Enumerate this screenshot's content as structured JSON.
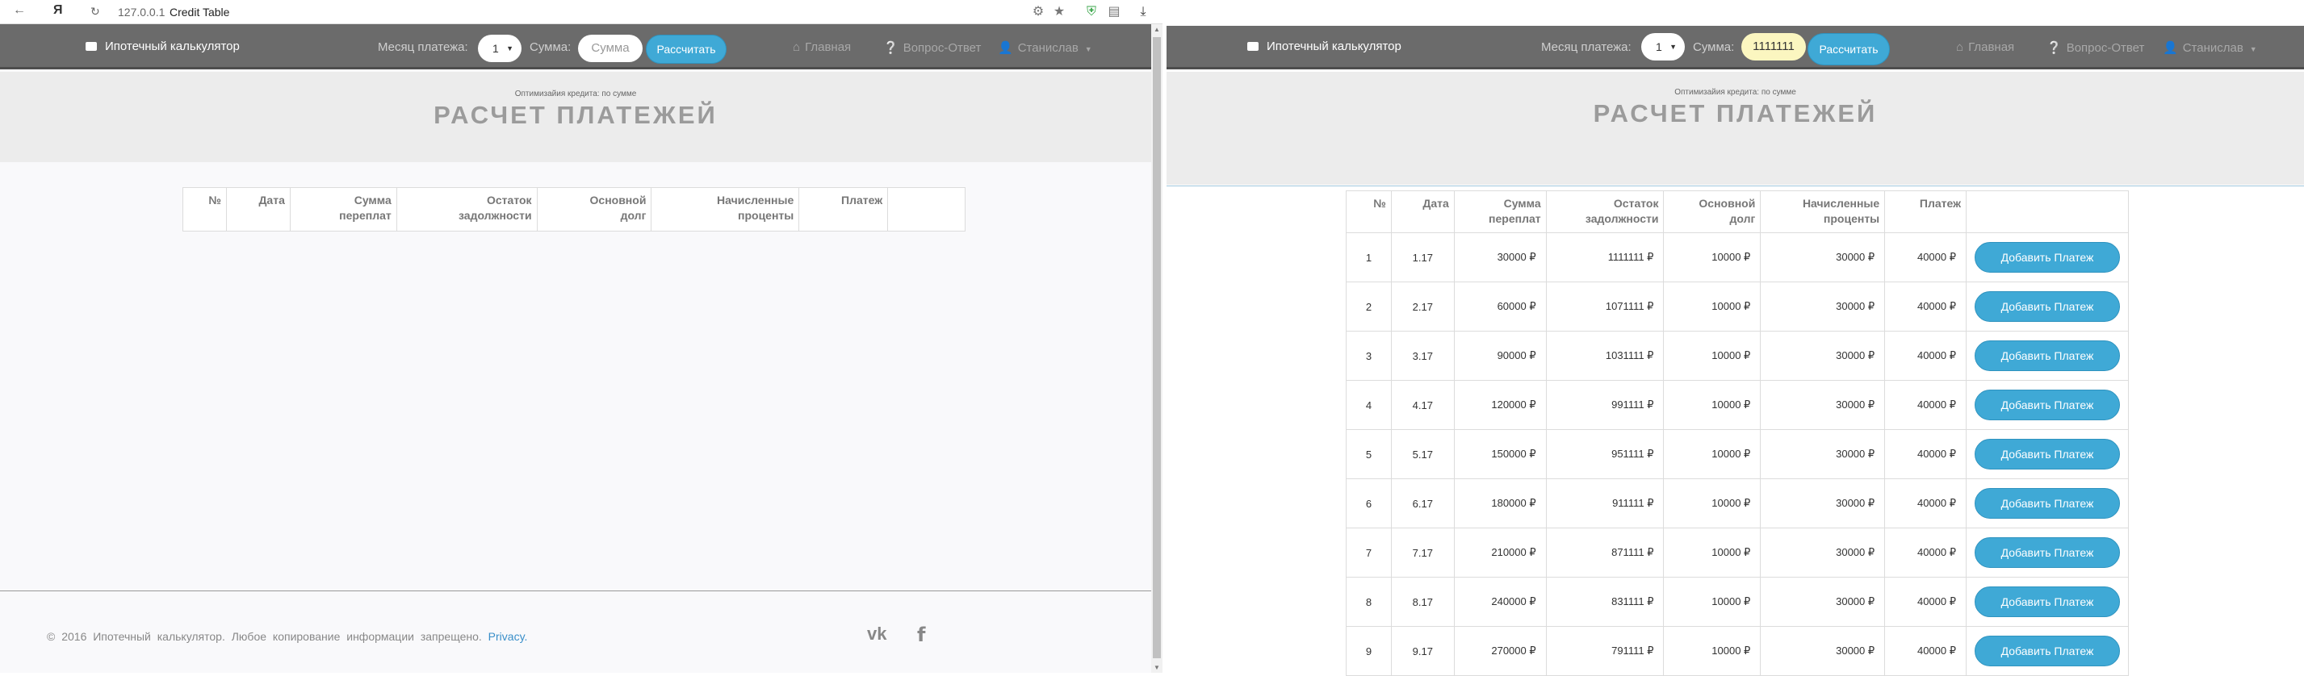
{
  "browser": {
    "url": "127.0.0.1",
    "tab_title": "Credit Table",
    "nav_icons": [
      "back-icon",
      "yandex-logo",
      "reload-icon"
    ],
    "extension_icons": [
      "extension-icon",
      "star-icon",
      "shield-icon",
      "downloads-icon",
      "download-icon"
    ]
  },
  "navbar": {
    "brand": "Ипотечный калькулятор",
    "month_label": "Месяц платежа:",
    "sum_label": "Сумма:",
    "calc_button": "Рассчитать",
    "menu": {
      "home": "Главная",
      "faq": "Вопрос-Ответ",
      "user": "Станислав"
    }
  },
  "left": {
    "month_value": "1",
    "sum_placeholder": "Сумма",
    "sum_value": ""
  },
  "right": {
    "month_value": "1",
    "sum_value": "1111111"
  },
  "hero": {
    "subtitle": "Оптимизайия кредита: по сумме",
    "title": "РАСЧЕТ ПЛАТЕЖЕЙ"
  },
  "table": {
    "headers": {
      "no": "№",
      "date": "Дата",
      "overpay_1": "Сумма",
      "overpay_2": "переплат",
      "balance_1": "Остаток",
      "balance_2": "задолжности",
      "principal_1": "Основной",
      "principal_2": "долг",
      "interest_1": "Начисленные",
      "interest_2": "проценты",
      "payment": "Платеж"
    },
    "add_button": "Добавить Платеж",
    "rows": [
      {
        "no": "1",
        "date": "1.17",
        "overpay": "30000 ₽",
        "balance": "1111111 ₽",
        "principal": "10000 ₽",
        "interest": "30000 ₽",
        "payment": "40000 ₽"
      },
      {
        "no": "2",
        "date": "2.17",
        "overpay": "60000 ₽",
        "balance": "1071111 ₽",
        "principal": "10000 ₽",
        "interest": "30000 ₽",
        "payment": "40000 ₽"
      },
      {
        "no": "3",
        "date": "3.17",
        "overpay": "90000 ₽",
        "balance": "1031111 ₽",
        "principal": "10000 ₽",
        "interest": "30000 ₽",
        "payment": "40000 ₽"
      },
      {
        "no": "4",
        "date": "4.17",
        "overpay": "120000 ₽",
        "balance": "991111 ₽",
        "principal": "10000 ₽",
        "interest": "30000 ₽",
        "payment": "40000 ₽"
      },
      {
        "no": "5",
        "date": "5.17",
        "overpay": "150000 ₽",
        "balance": "951111 ₽",
        "principal": "10000 ₽",
        "interest": "30000 ₽",
        "payment": "40000 ₽"
      },
      {
        "no": "6",
        "date": "6.17",
        "overpay": "180000 ₽",
        "balance": "911111 ₽",
        "principal": "10000 ₽",
        "interest": "30000 ₽",
        "payment": "40000 ₽"
      },
      {
        "no": "7",
        "date": "7.17",
        "overpay": "210000 ₽",
        "balance": "871111 ₽",
        "principal": "10000 ₽",
        "interest": "30000 ₽",
        "payment": "40000 ₽"
      },
      {
        "no": "8",
        "date": "8.17",
        "overpay": "240000 ₽",
        "balance": "831111 ₽",
        "principal": "10000 ₽",
        "interest": "30000 ₽",
        "payment": "40000 ₽"
      },
      {
        "no": "9",
        "date": "9.17",
        "overpay": "270000 ₽",
        "balance": "791111 ₽",
        "principal": "10000 ₽",
        "interest": "30000 ₽",
        "payment": "40000 ₽"
      }
    ]
  },
  "footer": {
    "copyright": "© 2016 Ипотечный калькулятор. Любое копирование информации запрещено.",
    "privacy": "Privacy.",
    "social_icons": [
      "vk-icon",
      "facebook-icon"
    ]
  }
}
